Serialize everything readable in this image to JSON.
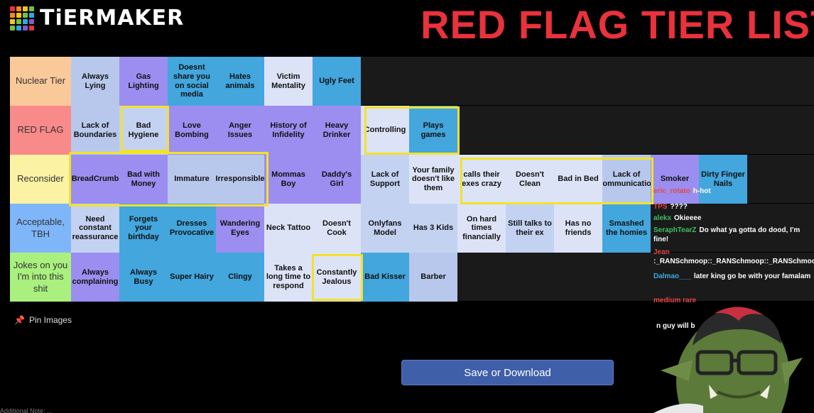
{
  "header": {
    "logo_text": "TiERMAKER",
    "title": "RED FLAG TIER LIST",
    "logo_colors": [
      "#e8323c",
      "#f08a24",
      "#f5c518",
      "#76c043",
      "#f08a24",
      "#f5c518",
      "#76c043",
      "#2fa8e0",
      "#f5c518",
      "#76c043",
      "#2fa8e0",
      "#7b5ec9",
      "#76c043",
      "#2fa8e0",
      "#7b5ec9",
      "#e8323c"
    ]
  },
  "tiers": [
    {
      "label": "Nuclear Tier",
      "color": "#f9c999",
      "items": [
        {
          "text": "Always Lying",
          "c": "c1"
        },
        {
          "text": "Gas Lighting",
          "c": "c2"
        },
        {
          "text": "Doesnt share you on social media",
          "c": "c3"
        },
        {
          "text": "Hates animals",
          "c": "c3"
        },
        {
          "text": "Victim Mentality",
          "c": "c5"
        },
        {
          "text": "Ugly Feet",
          "c": "c3"
        }
      ]
    },
    {
      "label": "RED FLAG",
      "color": "#f98a8a",
      "items": [
        {
          "text": "Lack of Boundaries",
          "c": "c1"
        },
        {
          "text": "Bad Hygiene",
          "c": "c4"
        },
        {
          "text": "Love Bombing",
          "c": "c2"
        },
        {
          "text": "Anger Issues",
          "c": "c2"
        },
        {
          "text": "History of Infidelity",
          "c": "c2"
        },
        {
          "text": "Heavy Drinker",
          "c": "c2"
        },
        {
          "text": "Controlling",
          "c": "c5"
        },
        {
          "text": "Plays games",
          "c": "c3"
        }
      ]
    },
    {
      "label": "Reconsider",
      "color": "#fbf2a3",
      "items": [
        {
          "text": "BreadCrumb",
          "c": "c2"
        },
        {
          "text": "Bad with Money",
          "c": "c2"
        },
        {
          "text": "Immature",
          "c": "c1"
        },
        {
          "text": "Irresponsible",
          "c": "c1"
        },
        {
          "text": "Mommas Boy",
          "c": "c2"
        },
        {
          "text": "Daddy's Girl",
          "c": "c2"
        },
        {
          "text": "Lack of Support",
          "c": "c4"
        },
        {
          "text": "Your family doesn't like them",
          "c": "c5"
        },
        {
          "text": "calls their exes crazy",
          "c": "c5"
        },
        {
          "text": "Doesn't Clean",
          "c": "c5"
        },
        {
          "text": "Bad in Bed",
          "c": "c5"
        },
        {
          "text": "Lack of Communication",
          "c": "c1"
        },
        {
          "text": "Smoker",
          "c": "c2"
        },
        {
          "text": "Dirty Finger Nails",
          "c": "c3"
        }
      ]
    },
    {
      "label": "Acceptable, TBH",
      "color": "#7fb6f9",
      "items": [
        {
          "text": "Need constant reassurance",
          "c": "c4"
        },
        {
          "text": "Forgets your birthday",
          "c": "c3"
        },
        {
          "text": "Dresses Provocative",
          "c": "c3"
        },
        {
          "text": "Wandering Eyes",
          "c": "c2"
        },
        {
          "text": "Neck Tattoo",
          "c": "c5"
        },
        {
          "text": "Doesn't Cook",
          "c": "c5"
        },
        {
          "text": "Onlyfans Model",
          "c": "c4"
        },
        {
          "text": "Has 3 Kids",
          "c": "c4"
        },
        {
          "text": "On hard times financially",
          "c": "c5"
        },
        {
          "text": "Still talks to their ex",
          "c": "c4"
        },
        {
          "text": "Has no friends",
          "c": "c5"
        },
        {
          "text": "Smashed the homies",
          "c": "c3"
        }
      ]
    },
    {
      "label": "Jokes on you I'm into this shit",
      "color": "#a9f07f",
      "items": [
        {
          "text": "Always complaining",
          "c": "c2"
        },
        {
          "text": "Always Busy",
          "c": "c3"
        },
        {
          "text": "Super Hairy",
          "c": "c3"
        },
        {
          "text": "Clingy",
          "c": "c3"
        },
        {
          "text": "Takes a long time to respond",
          "c": "c5"
        },
        {
          "text": "Constantly Jealous",
          "c": "c5"
        },
        {
          "text": "Bad Kisser",
          "c": "c3"
        },
        {
          "text": "Barber",
          "c": "c1"
        }
      ]
    }
  ],
  "pin_label": "Pin Images",
  "save_label": "Save or Download",
  "chat": [
    {
      "user": "eric_rotato",
      "msg": "h-hot",
      "color": "#e84545"
    },
    {
      "user": "TPS",
      "msg": "????",
      "color": "#e84545"
    },
    {
      "user": "alekx",
      "msg": "Okieeee",
      "color": "#3fbf5f"
    },
    {
      "user": "SeraphTearZ",
      "msg": "Do what ya gotta do dood, I'm fine!",
      "color": "#3fbf5f"
    },
    {
      "user": "Jean",
      "msg": ":_RANSchmoop::_RANSchmoop::_RANSchmoop:",
      "color": "#e84545"
    },
    {
      "user": "Dalmao___",
      "msg": "later king go be with your famalam",
      "color": "#3fa9e0"
    },
    {
      "user": "medium rare",
      "msg": "",
      "color": "#e84545"
    },
    {
      "user": "",
      "msg": "n guy will b",
      "color": "#3fbf5f"
    }
  ],
  "bottom_text": "Additional Note: ..."
}
